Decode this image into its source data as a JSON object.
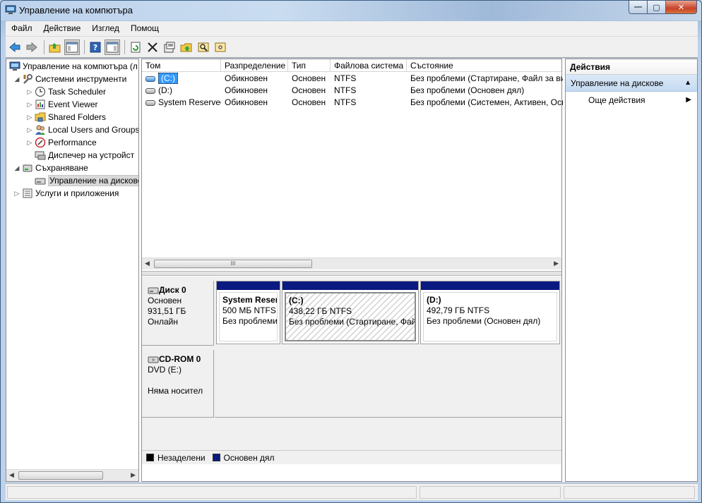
{
  "window": {
    "title": "Управление на компютъра",
    "controls": [
      "—",
      "▢",
      "✕"
    ]
  },
  "menu": [
    "Файл",
    "Действие",
    "Изглед",
    "Помощ"
  ],
  "toolbar": {
    "icons": [
      "back-icon",
      "forward-icon",
      "up-folder-icon",
      "show-hide-tree-icon",
      "help-icon",
      "show-hide-actions-icon",
      "refresh-icon",
      "delete-icon",
      "properties-icon",
      "open-icon",
      "rescan-icon",
      "settings-icon"
    ]
  },
  "tree": {
    "root": "Управление на компютъра (л",
    "system_tools": "Системни инструменти",
    "task_scheduler": "Task Scheduler",
    "event_viewer": "Event Viewer",
    "shared_folders": "Shared Folders",
    "local_users": "Local Users and Groups",
    "performance": "Performance",
    "device_manager": "Диспечер на устройст",
    "storage": "Съхраняване",
    "disk_management": "Управление на дискове",
    "services": "Услуги и приложения"
  },
  "volumes": {
    "headers": [
      "Том",
      "Разпределение",
      "Тип",
      "Файлова система",
      "Състояние"
    ],
    "rows": [
      {
        "name": "(C:)",
        "layout": "Обикновен",
        "type": "Основен",
        "fs": "NTFS",
        "status": "Без проблеми (Стартиране, Файл за ви"
      },
      {
        "name": "(D:)",
        "layout": "Обикновен",
        "type": "Основен",
        "fs": "NTFS",
        "status": "Без проблеми (Основен дял)"
      },
      {
        "name": "System Reserved",
        "layout": "Обикновен",
        "type": "Основен",
        "fs": "NTFS",
        "status": "Без проблеми (Системен, Активен, Осн"
      }
    ]
  },
  "disks": {
    "disk0": {
      "name": "Диск 0",
      "kind": "Основен",
      "size": "931,51 ГБ",
      "state": "Онлайн"
    },
    "cdrom0": {
      "name": "CD-ROM 0",
      "kind": "DVD (E:)",
      "media": "Няма носител"
    },
    "partitions": [
      {
        "name": "System Reser",
        "size": "500 МБ NTFS",
        "status": "Без проблеми"
      },
      {
        "name": "(C:)",
        "size": "438,22 ГБ NTFS",
        "status": "Без проблеми (Стартиране, Фай"
      },
      {
        "name": "(D:)",
        "size": "492,79 ГБ NTFS",
        "status": "Без проблеми (Основен дял)"
      }
    ]
  },
  "legend": {
    "unallocated": "Незаделени",
    "primary": "Основен дял",
    "unallocated_color": "#000000",
    "primary_color": "#0a1a80"
  },
  "actions": {
    "header": "Действия",
    "section": "Управление на дискове",
    "more": "Още действия"
  },
  "scroll_thumb": "III"
}
